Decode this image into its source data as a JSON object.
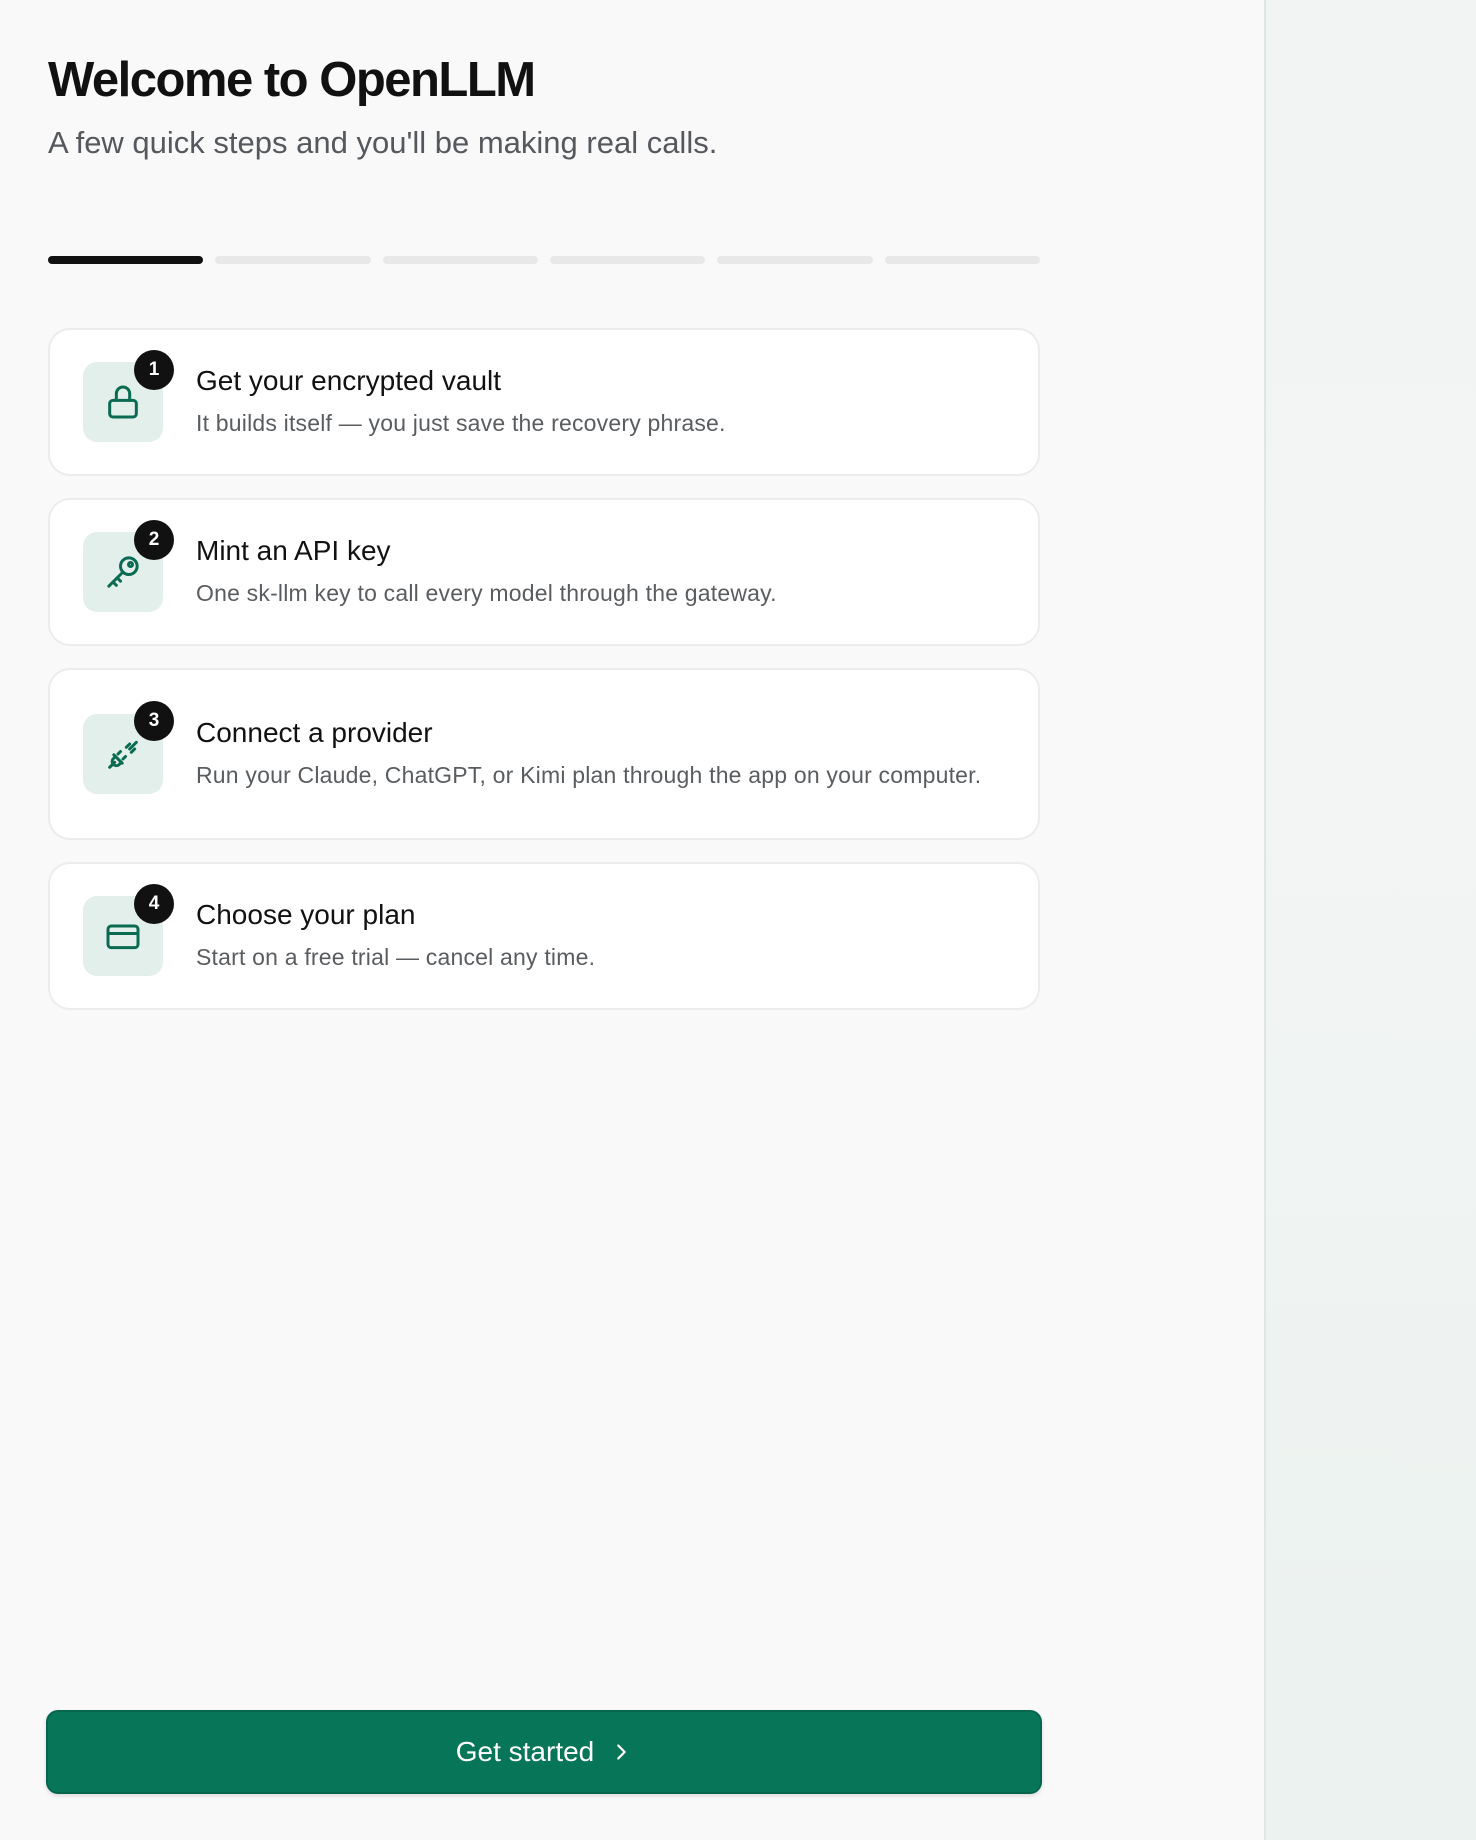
{
  "header": {
    "title": "Welcome to OpenLLM",
    "subtitle": "A few quick steps and you'll be making real calls."
  },
  "progress": {
    "total_steps": 6,
    "current_step": 1
  },
  "steps": [
    {
      "number": "1",
      "icon": "lock-icon",
      "title": "Get your encrypted vault",
      "description": "It builds itself — you just save the recovery phrase."
    },
    {
      "number": "2",
      "icon": "key-icon",
      "title": "Mint an API key",
      "description": "One sk-llm key to call every model through the gateway."
    },
    {
      "number": "3",
      "icon": "plug-icon",
      "title": "Connect a provider",
      "description": "Run your Claude, ChatGPT, or Kimi plan through the app on your computer."
    },
    {
      "number": "4",
      "icon": "credit-card-icon",
      "title": "Choose your plan",
      "description": "Start on a free trial — cancel any time."
    }
  ],
  "cta": {
    "label": "Get started",
    "icon": "chevron-right-icon"
  },
  "colors": {
    "accent": "#067558",
    "icon_bg": "#e3efeb",
    "icon_stroke": "#0b6b52"
  }
}
